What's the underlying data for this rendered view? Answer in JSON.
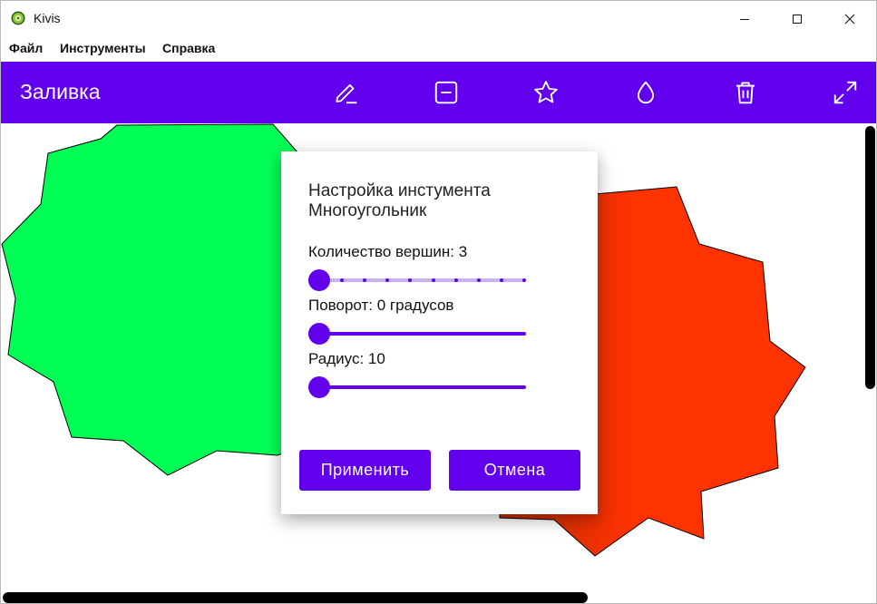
{
  "window": {
    "title": "Kivis"
  },
  "menu": {
    "file": "Файл",
    "tools": "Инструменты",
    "help": "Справка"
  },
  "appbar": {
    "title": "Заливка",
    "color": "#6200ee",
    "tools": [
      "pencil-icon",
      "minus-box-icon",
      "star-icon",
      "drop-icon",
      "trash-icon",
      "expand-icon"
    ]
  },
  "canvas": {
    "shapes": [
      {
        "name": "green-polygon",
        "color": "#00ff55"
      },
      {
        "name": "orange-polygon",
        "color": "#ff3300"
      }
    ]
  },
  "dialog": {
    "title": "Настройка инстумента Многоугольник",
    "vertices": {
      "label": "Количество вершин: 3",
      "value": 3,
      "min": 3,
      "max": 12
    },
    "rotation": {
      "label": "Поворот: 0 градусов",
      "value": 0
    },
    "radius": {
      "label": "Радиус: 10",
      "value": 10
    },
    "apply_label": "Применить",
    "cancel_label": "Отмена"
  }
}
